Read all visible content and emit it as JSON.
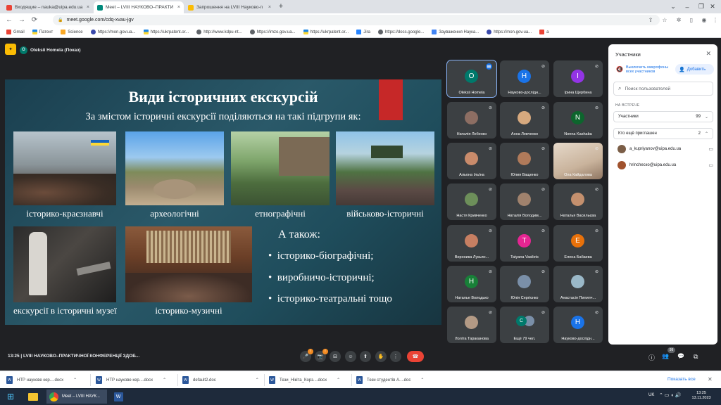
{
  "tabs": [
    {
      "label": "Входящие – nauka@uipa.edu.ua",
      "favicon_color": "#ea4335"
    },
    {
      "label": "Meet – LVIII НАУКОВО–ПРАКТИ",
      "favicon_color": "#00897b"
    },
    {
      "label": "Запрошення на LVIII Науково-п",
      "favicon_color": "#fbbc04"
    }
  ],
  "tab_close": "×",
  "new_tab": "+",
  "window_controls": {
    "menu": "⌄",
    "minimize": "–",
    "maximize": "❐",
    "close": "✕"
  },
  "nav": {
    "back": "←",
    "forward": "→",
    "reload": "⟳"
  },
  "address": {
    "lock": "🔒",
    "url": "meet.google.com/cdq-xvau-jgv"
  },
  "bookmarks": [
    {
      "label": "Gmail",
      "color": "#ea4335"
    },
    {
      "label": "Патент",
      "color": "#1e88e5"
    },
    {
      "label": "Science",
      "color": "#f9a825"
    },
    {
      "label": "https://mon.gov.ua...",
      "color": "#3949ab"
    },
    {
      "label": "https://ukrpatent.or...",
      "color": "#1e88e5"
    },
    {
      "label": "http://www.kdpu-nt...",
      "color": "#5f6368"
    },
    {
      "label": "https://imzo.gov.ua...",
      "color": "#5f6368"
    },
    {
      "label": "https://ukrpatent.or...",
      "color": "#1e88e5"
    },
    {
      "label": "Jira",
      "color": "#2684ff"
    },
    {
      "label": "https://docs.google...",
      "color": "#5f6368"
    },
    {
      "label": "Зауваження Наука...",
      "color": "#4285f4"
    },
    {
      "label": "https://mon.gov.ua...",
      "color": "#3949ab"
    },
    {
      "label": "a",
      "color": "#ea4335"
    }
  ],
  "presenter": {
    "initial": "O",
    "label": "Oleksii Homela (Показ)"
  },
  "slide": {
    "title": "Види історичних екскурсій",
    "subtitle": "За змістом історичні екскурсії поділяються на такі підгрупи як:",
    "captions": [
      "історико-краєзнавчі",
      "археологічні",
      "етнографічні",
      "військово-історичні",
      "екскурсії в історичні музеї",
      "історико-музичні"
    ],
    "also_heading": "А також:",
    "also_items": [
      "історико-біографічні;",
      "виробничо-історичні;",
      "історико-театральні тощо"
    ]
  },
  "tiles": [
    {
      "name": "Oleksii Homela",
      "initial": "O",
      "color": "#00796b",
      "speaking": true
    },
    {
      "name": "Науково-дослідн...",
      "initial": "Н",
      "color": "#1a73e8"
    },
    {
      "name": "Ірина Щербина",
      "initial": "І",
      "color": "#9334e6"
    },
    {
      "name": "Наталія Лебенко",
      "initial": "",
      "color": "#8d6e63"
    },
    {
      "name": "Анна Левченко",
      "initial": "",
      "color": "#d7a97e"
    },
    {
      "name": "Nonna Kashaba",
      "initial": "N",
      "color": "#0d652d"
    },
    {
      "name": "Альона Ільїна",
      "initial": "",
      "color": "#c98b6b"
    },
    {
      "name": "Юлия Ващенко",
      "initial": "",
      "color": "#b07a5a"
    },
    {
      "name": "Ола Кайдалова",
      "initial": "",
      "color": "#d9b89c",
      "video": true
    },
    {
      "name": "Настя Кривченко",
      "initial": "",
      "color": "#6d8f5a"
    },
    {
      "name": "Наталія Володим...",
      "initial": "",
      "color": "#a0826d"
    },
    {
      "name": "Наталья Васильєва",
      "initial": "",
      "color": "#c4906e"
    },
    {
      "name": "Вероника Лукьян...",
      "initial": "",
      "color": "#c77f62"
    },
    {
      "name": "Tatyana Vasilets",
      "initial": "T",
      "color": "#e52592"
    },
    {
      "name": "Елена Бабаева",
      "initial": "Е",
      "color": "#e8710a"
    },
    {
      "name": "Наталье Володько",
      "initial": "Н",
      "color": "#188038"
    },
    {
      "name": "Юлія Сергієнко",
      "initial": "",
      "color": "#7a8fa8"
    },
    {
      "name": "Анастасія Пилипч...",
      "initial": "",
      "color": "#9ab8c8"
    },
    {
      "name": "Лоліта Тараканова",
      "initial": "",
      "color": "#b39a85"
    },
    {
      "name": "Ещё 79 чел.",
      "initial": "С",
      "color": "#00796b",
      "more": true
    },
    {
      "name": "Науково-дослідн...",
      "initial": "Н",
      "color": "#1a73e8"
    }
  ],
  "meeting_info": "13:25  |  LVIII НАУКОВО–ПРАКТИЧНОЇ КОНФЕРЕНЦІЇ ЗДОБ...",
  "controls": {
    "mic_badge": "!",
    "cam_badge": "!",
    "icons": [
      "🎤",
      "📷",
      "⊟",
      "☺",
      "⬆",
      "✋",
      "⋮",
      "☎"
    ]
  },
  "right_controls": {
    "info": "ⓘ",
    "people": "👥",
    "people_count": "99",
    "chat": "💬",
    "activities": "⧉"
  },
  "panel": {
    "title": "Участники",
    "close": "✕",
    "mute_all": "Выключить микрофоны всех участников",
    "add": "Добавить",
    "search_placeholder": "Поиск пользователей",
    "in_meeting": "НА ВСТРЕЧЕ",
    "participants_label": "Участники",
    "participants_count": "99",
    "invited_label": "Кто ещё приглашен",
    "invited_count": "2",
    "invited": [
      {
        "email": "a_kupriyanov@uipa.edu.ua",
        "color": "#7b5e47"
      },
      {
        "email": "hrincheско@uipa.edu.ua",
        "color": "#a0522d"
      }
    ]
  },
  "downloads": [
    "НТР наукове кер....docx",
    "НТР наукове кер....docx",
    "default2.doc",
    "Тези_Нікіта_Корз....docx",
    "Тези студентів А....doc"
  ],
  "show_all": "Показать все",
  "dl_close": "✕",
  "taskbar": {
    "start": "⊞",
    "chrome_label": "Meet – LVIII НАУК...",
    "lang": "UK",
    "time": "13:25",
    "date": "13.11.2023"
  }
}
